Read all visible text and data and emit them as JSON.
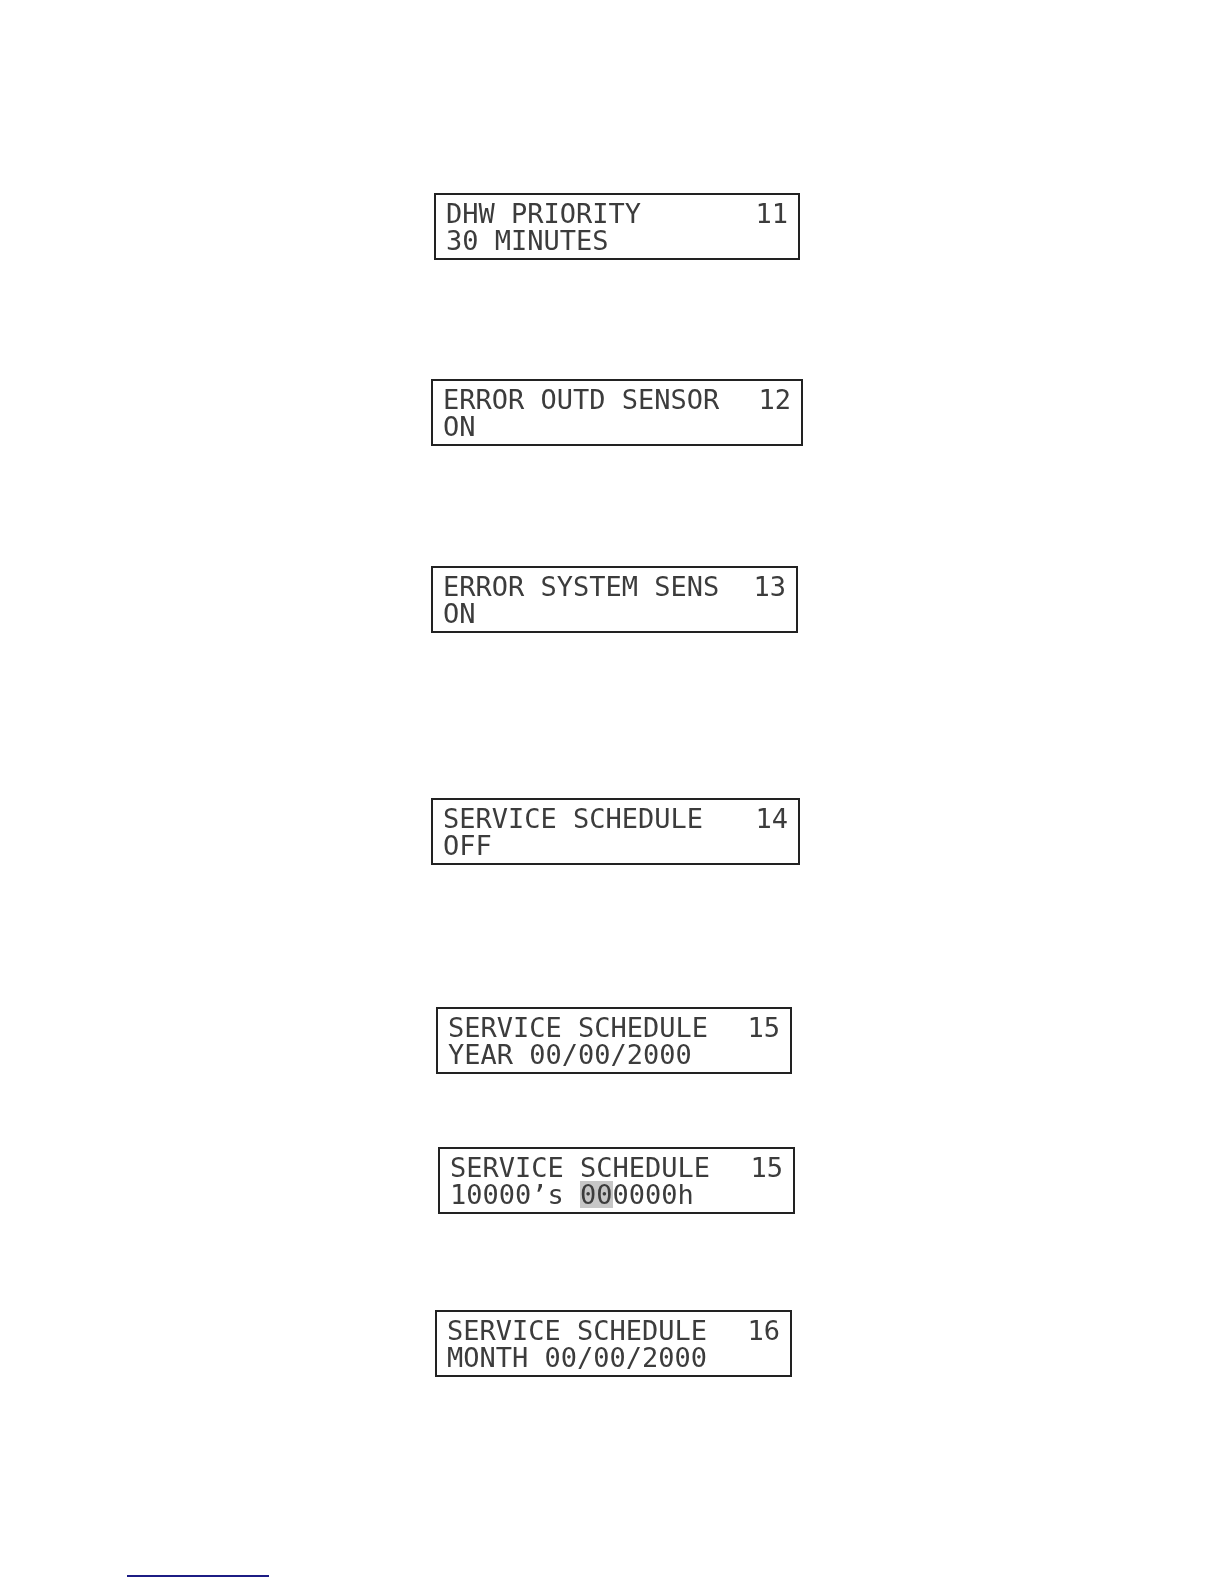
{
  "displays": [
    {
      "title": "DHW PRIORITY",
      "number": "11",
      "value": "30 MINUTES"
    },
    {
      "title": "ERROR OUTD SENSOR",
      "number": "12",
      "value": "ON"
    },
    {
      "title": "ERROR SYSTEM SENS",
      "number": "13",
      "value": "ON"
    },
    {
      "title": "SERVICE SCHEDULE",
      "number": "14",
      "value": "OFF"
    },
    {
      "title": "SERVICE SCHEDULE",
      "number": "15",
      "value": "YEAR 00/00/2000"
    },
    {
      "title": "SERVICE SCHEDULE",
      "number": "15",
      "value": "10000’s",
      "entry": [
        {
          "text": "00",
          "highlighted": true
        },
        {
          "text": "0000h",
          "highlighted": false
        }
      ]
    },
    {
      "title": "SERVICE SCHEDULE",
      "number": "16",
      "value": "MONTH 00/00/2000"
    }
  ]
}
